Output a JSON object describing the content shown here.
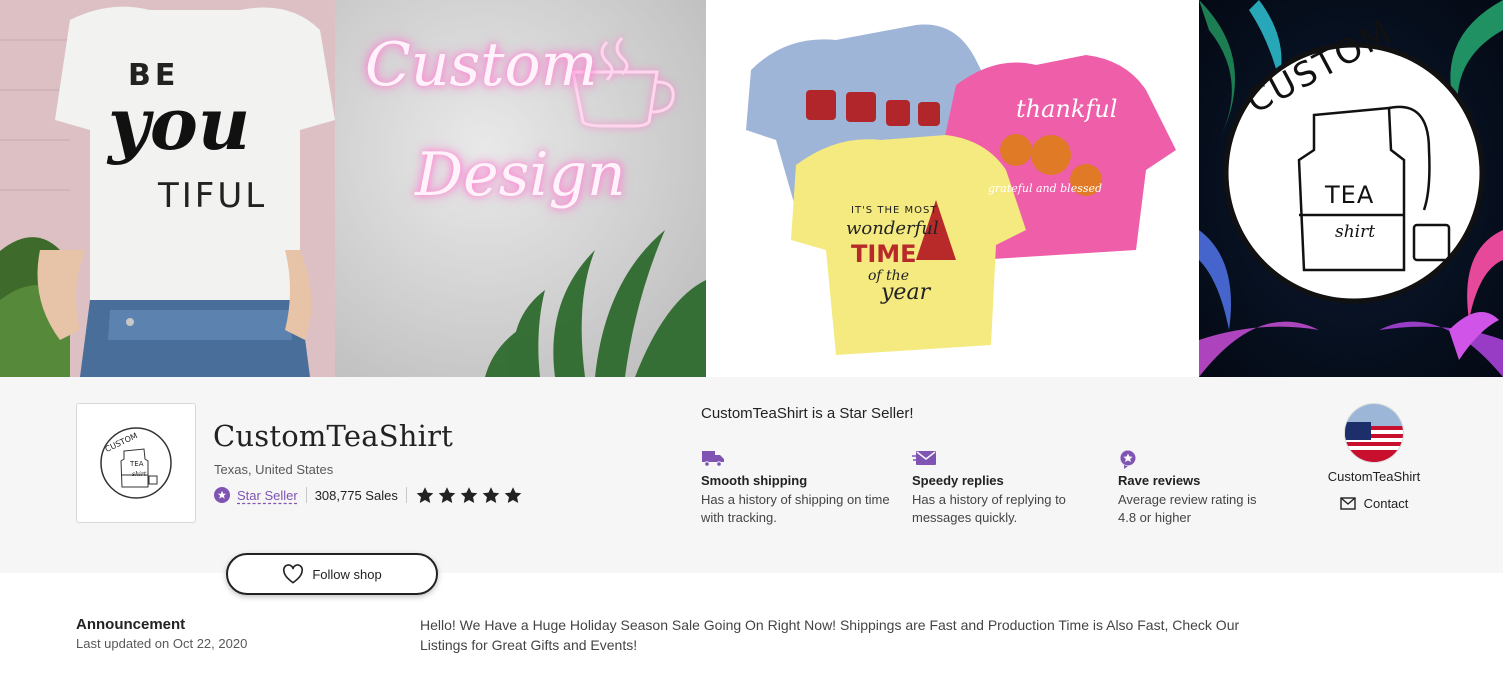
{
  "banner": {
    "panel1_lines": [
      "BE",
      "you",
      "TIFUL"
    ],
    "panel2_lines": [
      "Custom",
      "Design"
    ],
    "panel3_yellow_lines": [
      "IT'S THE MOST",
      "wonderful",
      "TIME",
      "of the",
      "year"
    ],
    "panel3_pink_lines": [
      "thankful",
      "grateful and blessed"
    ],
    "panel4_lines": [
      "CUSTOM",
      "TEA",
      "shirt"
    ]
  },
  "shop": {
    "logo_lines": [
      "CUSTOM",
      "TEA",
      "shirt"
    ],
    "name": "CustomTeaShirt",
    "location": "Texas, United States",
    "star_seller_label": "Star Seller",
    "sales": "308,775 Sales",
    "rating_stars": 5
  },
  "star_seller": {
    "title": "CustomTeaShirt is a Star Seller!",
    "badges": [
      {
        "icon": "truck-icon",
        "title": "Smooth shipping",
        "desc": "Has a history of shipping on time with tracking."
      },
      {
        "icon": "mail-icon",
        "title": "Speedy replies",
        "desc": "Has a history of replying to messages quickly."
      },
      {
        "icon": "star-badge-icon",
        "title": "Rave reviews",
        "desc": "Average review rating is 4.8 or higher"
      }
    ]
  },
  "owner": {
    "name": "CustomTeaShirt",
    "contact_label": "Contact"
  },
  "follow": {
    "label": "Follow shop"
  },
  "announcement": {
    "title": "Announcement",
    "date": "Last updated on Oct 22, 2020",
    "text": "Hello! We Have a Huge Holiday Season Sale Going On Right Now! Shippings are Fast and Production Time is Also Fast, Check Our Listings for Great Gifts and Events!"
  },
  "colors": {
    "accent": "#7f54b3",
    "text": "#222222",
    "muted": "#595959",
    "strip_bg": "#f6f6f6"
  }
}
